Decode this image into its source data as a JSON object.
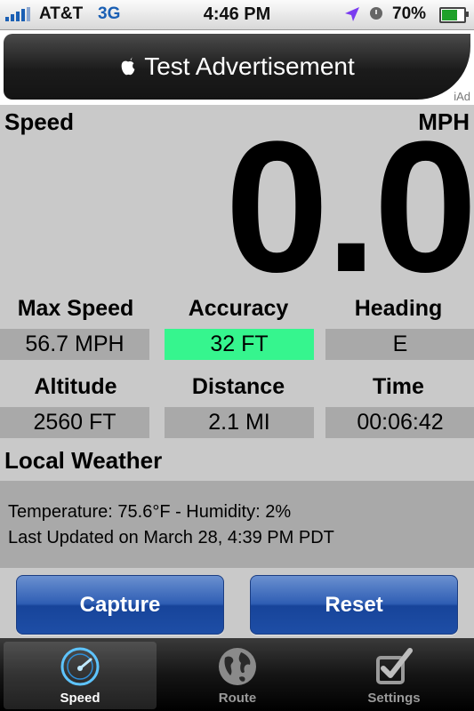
{
  "status_bar": {
    "carrier": "AT&T",
    "network": "3G",
    "time": "4:46 PM",
    "battery_percent": "70%",
    "battery_level": 0.7
  },
  "ad_banner": {
    "title": "Test Advertisement",
    "badge": "iAd"
  },
  "speed": {
    "label": "Speed",
    "unit": "MPH",
    "value": "0.0"
  },
  "stats": {
    "max_speed": {
      "label": "Max Speed",
      "value": "56.7 MPH"
    },
    "accuracy": {
      "label": "Accuracy",
      "value": "32 FT",
      "color": "#36f58e"
    },
    "heading": {
      "label": "Heading",
      "value": "E"
    },
    "altitude": {
      "label": "Altitude",
      "value": "2560 FT"
    },
    "distance": {
      "label": "Distance",
      "value": "2.1 MI"
    },
    "time": {
      "label": "Time",
      "value": "00:06:42"
    }
  },
  "weather": {
    "title": "Local Weather",
    "line1": "Temperature: 75.6°F - Humidity: 2%",
    "line2": "Last Updated on March 28, 4:39 PM PDT"
  },
  "buttons": {
    "capture": "Capture",
    "reset": "Reset"
  },
  "tabs": [
    {
      "label": "Speed",
      "icon": "speedometer-icon",
      "selected": true
    },
    {
      "label": "Route",
      "icon": "globe-icon",
      "selected": false
    },
    {
      "label": "Settings",
      "icon": "checkbox-icon",
      "selected": false
    }
  ],
  "colors": {
    "button_blue": "#2f5eb4",
    "accuracy_green": "#36f58e",
    "signal_blue": "#1a5fb4"
  }
}
